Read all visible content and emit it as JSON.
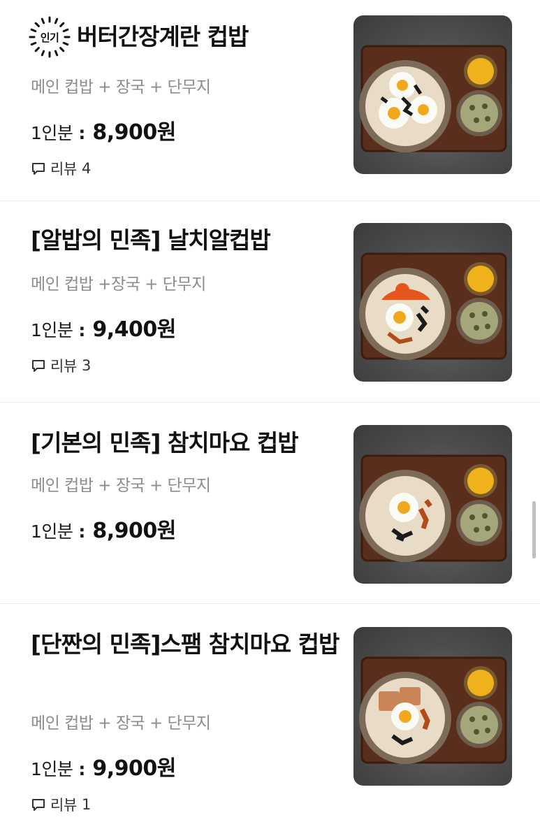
{
  "items": [
    {
      "badge": "인기",
      "title": "버터간장계란 컵밥",
      "description": "메인 컵밥 + 장국 + 단무지",
      "price_label": "1인분",
      "price_sep": ":",
      "price": "8,900원",
      "review_label": "리뷰",
      "review_count": "4",
      "photo_icon": "butter-egg-cupbap-photo"
    },
    {
      "title": "[알밥의 민족] 날치알컵밥",
      "description": "메인 컵밥 +장국 + 단무지",
      "price_label": "1인분",
      "price_sep": ":",
      "price": "9,400원",
      "review_label": "리뷰",
      "review_count": "3",
      "photo_icon": "flying-fish-roe-cupbap-photo"
    },
    {
      "title": "[기본의 민족] 참치마요 컵밥",
      "description": "메인 컵밥 + 장국 + 단무지",
      "price_label": "1인분",
      "price_sep": ":",
      "price": "8,900원",
      "photo_icon": "tuna-mayo-cupbap-photo"
    },
    {
      "title": "[단짠의 민족]스팸 참치마요 컵밥",
      "description": "메인 컵밥 + 장국 + 단무지",
      "price_label": "1인분",
      "price_sep": ":",
      "price": "9,900원",
      "review_label": "리뷰",
      "review_count": "1",
      "photo_icon": "spam-tuna-mayo-cupbap-photo"
    }
  ],
  "colors": {
    "background": "#ffffff",
    "title": "#111111",
    "description": "#8c8c8c",
    "divider": "#ececec",
    "photo_bg": "#4d4d4d",
    "tray": "#5a2e1c",
    "egg_yolk": "#f2a81d",
    "roe": "#e4561e"
  }
}
